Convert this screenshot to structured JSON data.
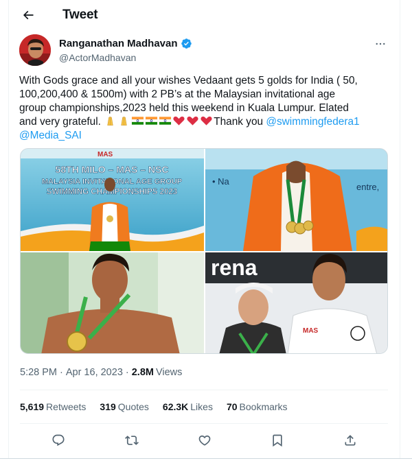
{
  "header": {
    "title": "Tweet",
    "back_icon": "arrow-left-icon"
  },
  "author": {
    "display_name": "Ranganathan Madhavan",
    "handle": "@ActorMadhavan",
    "verified": true,
    "verified_color": "#1d9bf0"
  },
  "tweet": {
    "lines": [
      "With Gods grace and all your wishes Vedaant gets 5 golds for India ( 50,",
      "100,200,400 & 1500m) with 2 PB’s at the Malaysian invitational age",
      "group championships,2023 held this weekend in Kuala Lumpur. Elated"
    ],
    "line4_text": "and very grateful.",
    "line4_tail": "Thank you",
    "mention1": "@swimmingfedera1",
    "mention2": "@Media_SAI",
    "emojis": [
      "folded-hands",
      "folded-hands",
      "india-flag",
      "india-flag",
      "india-flag",
      "red-heart",
      "red-heart",
      "red-heart"
    ]
  },
  "media": {
    "banner_line1": "58TH MILO – MAS – NSC",
    "banner_line2": "MALAYSIA INVITATIONAL AGE GROUP",
    "banner_line3": "SWIMMING CHAMPIONSHIPS 2023",
    "banner_top": "MAS",
    "photo2_text": "• Na",
    "photo2_text2": "entre,",
    "photo4_brand": "rena",
    "photo4_shirt": "MAS"
  },
  "meta": {
    "time": "5:28 PM",
    "date": "Apr 16, 2023",
    "views_count": "2.8M",
    "views_label": "Views"
  },
  "stats": {
    "retweets_count": "5,619",
    "retweets_label": "Retweets",
    "quotes_count": "319",
    "quotes_label": "Quotes",
    "likes_count": "62.3K",
    "likes_label": "Likes",
    "bookmarks_count": "70",
    "bookmarks_label": "Bookmarks"
  },
  "actions": [
    "reply-icon",
    "retweet-icon",
    "like-icon",
    "bookmark-icon",
    "share-icon"
  ],
  "colors": {
    "accent": "#1d9bf0",
    "text": "#0f1419",
    "muted": "#536471",
    "border": "#eff3f4"
  }
}
